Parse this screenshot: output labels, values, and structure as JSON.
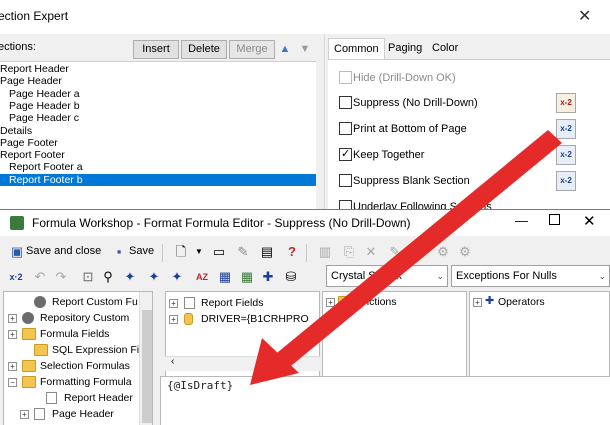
{
  "section_expert": {
    "title": "ection Expert",
    "sections_label": "ections:",
    "buttons": {
      "insert": "Insert",
      "delete": "Delete",
      "merge": "Merge"
    },
    "sections": [
      {
        "label": "Report Header",
        "indent": 0,
        "selected": false
      },
      {
        "label": "Page Header",
        "indent": 0,
        "selected": false
      },
      {
        "label": "Page Header a",
        "indent": 1,
        "selected": false
      },
      {
        "label": "Page Header b",
        "indent": 1,
        "selected": false
      },
      {
        "label": "Page Header c",
        "indent": 1,
        "selected": false
      },
      {
        "label": "Details",
        "indent": 0,
        "selected": false
      },
      {
        "label": "Page Footer",
        "indent": 0,
        "selected": false
      },
      {
        "label": "Report Footer",
        "indent": 0,
        "selected": false
      },
      {
        "label": "Report Footer a",
        "indent": 1,
        "selected": false
      },
      {
        "label": "Report Footer b",
        "indent": 1,
        "selected": true
      }
    ],
    "tabs": [
      {
        "label": "Common",
        "active": true
      },
      {
        "label": "Paging",
        "active": false
      },
      {
        "label": "Color",
        "active": false
      }
    ],
    "options": [
      {
        "label": "Hide (Drill-Down OK)",
        "checked": false,
        "disabled": true
      },
      {
        "label": "Suppress (No Drill-Down)",
        "checked": false,
        "disabled": false
      },
      {
        "label": "Print at Bottom of Page",
        "checked": false,
        "disabled": false
      },
      {
        "label": "Keep Together",
        "checked": true,
        "disabled": false
      },
      {
        "label": "Suppress Blank Section",
        "checked": false,
        "disabled": false
      },
      {
        "label": "Underlay Following Sections",
        "checked": false,
        "disabled": false
      }
    ],
    "formula_button_label": "x-2"
  },
  "formula_workshop": {
    "title": "Formula Workshop - Format Formula Editor - Suppress (No Drill-Down)",
    "toolbar": {
      "save_and_close": "Save and close",
      "save": "Save"
    },
    "syntax_dropdown": "Crystal Syntax",
    "nulls_dropdown": "Exceptions For Nulls",
    "left_tree": [
      {
        "label": "Report Custom Fu",
        "indent": 1,
        "icon": "gear",
        "expand": ""
      },
      {
        "label": "Repository Custom",
        "indent": 0,
        "icon": "gear",
        "expand": "+"
      },
      {
        "label": "Formula Fields",
        "indent": 0,
        "icon": "folder",
        "expand": "+"
      },
      {
        "label": "SQL Expression Fie",
        "indent": 1,
        "icon": "folder",
        "expand": ""
      },
      {
        "label": "Selection Formulas",
        "indent": 0,
        "icon": "folder",
        "expand": "+"
      },
      {
        "label": "Formatting Formula",
        "indent": 0,
        "icon": "folder",
        "expand": "−"
      },
      {
        "label": "Report Header",
        "indent": 2,
        "icon": "doc",
        "expand": ""
      },
      {
        "label": "Page Header",
        "indent": 1,
        "icon": "doc",
        "expand": "+"
      }
    ],
    "fields_tree": [
      {
        "label": "Report Fields",
        "expand": "+",
        "icon": "doc"
      },
      {
        "label": "DRIVER={B1CRHPRO",
        "expand": "+",
        "icon": "db"
      }
    ],
    "functions_label": "Functions",
    "operators_label": "Operators",
    "editor_text": "{@IsDraft}"
  },
  "colors": {
    "selection": "#0078d7",
    "arrow": "#e52a2a",
    "window_bg": "#f0f0f0"
  }
}
